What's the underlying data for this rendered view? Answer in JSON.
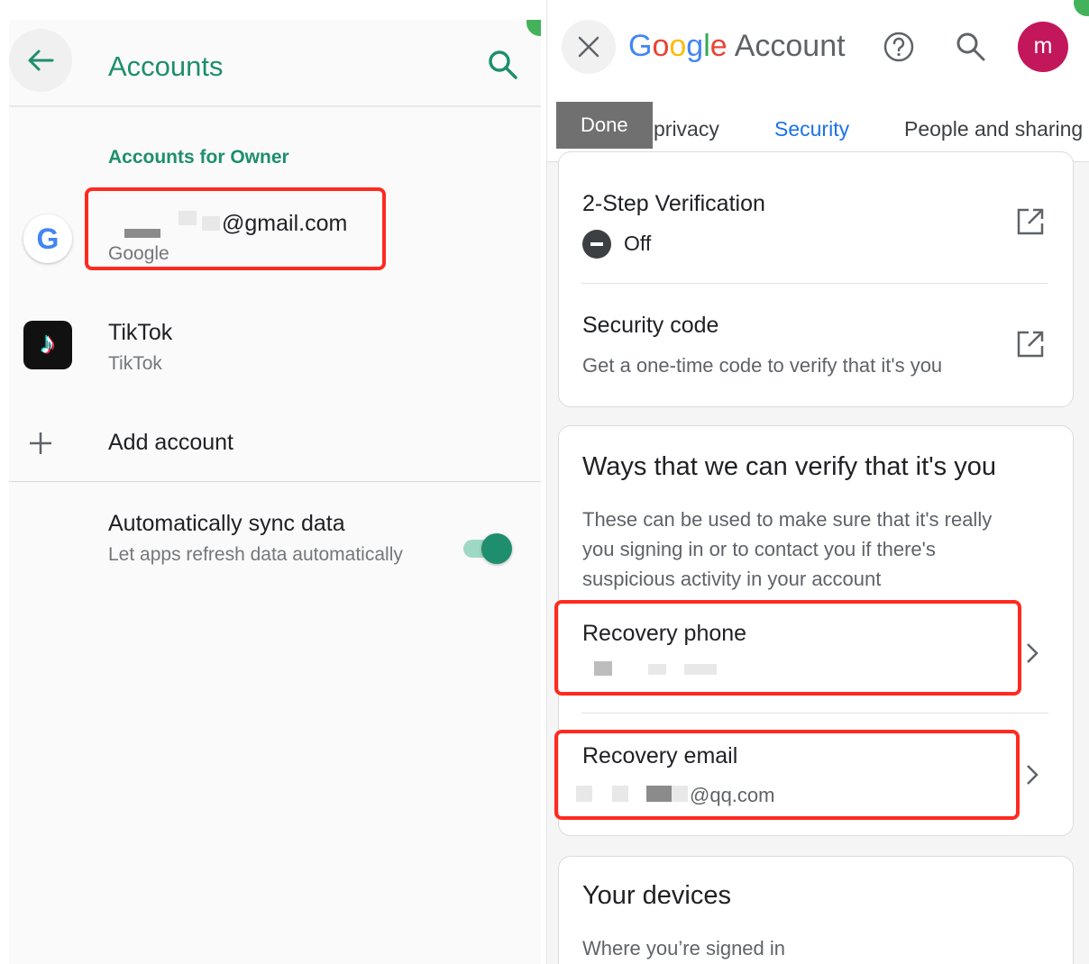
{
  "left": {
    "title": "Accounts",
    "section_label": "Accounts for Owner",
    "accounts": [
      {
        "icon": "google-g-icon",
        "glyph": "G",
        "title": "@gmail.com",
        "subtitle": "Google"
      },
      {
        "icon": "tiktok-icon",
        "glyph": "♪",
        "title": "TikTok",
        "subtitle": "TikTok"
      }
    ],
    "add_account": "Add account",
    "sync": {
      "title": "Automatically sync data",
      "subtitle": "Let apps refresh data automatically",
      "enabled": true
    }
  },
  "right": {
    "brand": {
      "g1": "G",
      "g2": "o",
      "g3": "o",
      "g4": "g",
      "g5": "l",
      "g6": "e",
      "suffix": "Account"
    },
    "avatar_letter": "m",
    "tabs": [
      "Data and privacy",
      "Security",
      "People and sharing"
    ],
    "tab_visible": {
      "partial_privacy": "privacy"
    },
    "active_tab": "Security",
    "toast": "Done",
    "two_step": {
      "title": "2-Step Verification",
      "status": "Off"
    },
    "security_code": {
      "title": "Security code",
      "subtitle": "Get a one-time code to verify that it's you"
    },
    "verify": {
      "title": "Ways that we can verify that it's you",
      "description": "These can be used to make sure that it's really you signing in or to contact you if there's suspicious activity in your account",
      "recovery_phone": {
        "title": "Recovery phone",
        "value": ""
      },
      "recovery_email": {
        "title": "Recovery email",
        "value": "@qq.com"
      }
    },
    "devices": {
      "title": "Your devices",
      "subtitle": "Where you’re signed in"
    }
  },
  "colors": {
    "android_accent": "#1e8e6e",
    "google_blue": "#1a73e8",
    "highlight": "#ff2a1f",
    "avatar": "#c2185b"
  }
}
